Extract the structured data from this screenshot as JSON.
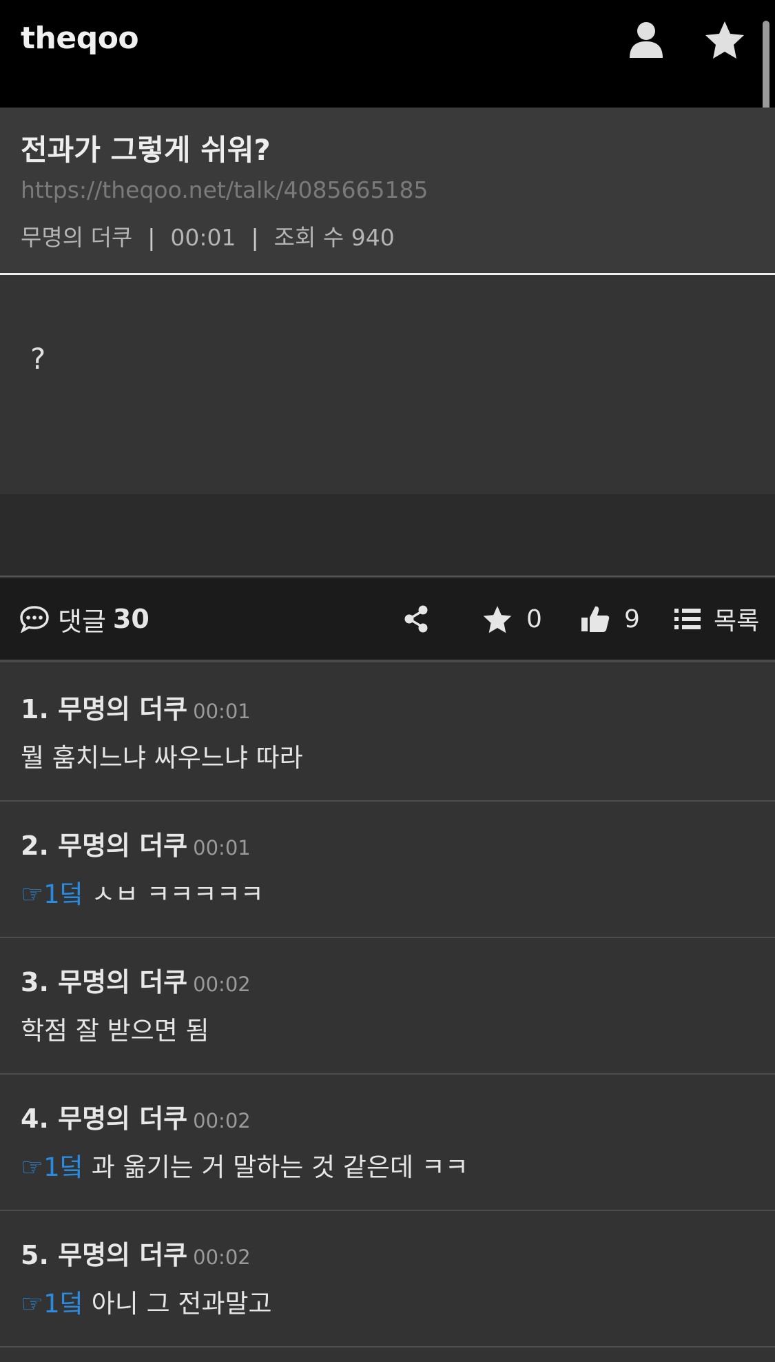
{
  "header": {
    "logo": "theqoo",
    "icons": [
      "user-icon",
      "star-icon"
    ]
  },
  "post": {
    "title": "전과가 그렇게 쉬워?",
    "url": "https://theqoo.net/talk/4085665185",
    "author": "무명의 더쿠",
    "time": "00:01",
    "views_label": "조회 수 940",
    "body": "?"
  },
  "actions": {
    "comments_label": "댓글",
    "comments_count": "30",
    "favorite_count": "0",
    "like_count": "9",
    "list_label": "목록"
  },
  "comments": [
    {
      "author": "1. 무명의 더쿠",
      "time": "00:01",
      "reply": "",
      "text": "뭘 훔치느냐 싸우느냐 따라"
    },
    {
      "author": "2. 무명의 더쿠",
      "time": "00:01",
      "reply": "☞1덬",
      "text": "ㅅㅂ ㅋㅋㅋㅋㅋ"
    },
    {
      "author": "3. 무명의 더쿠",
      "time": "00:02",
      "reply": "",
      "text": "학점 잘 받으면 됨"
    },
    {
      "author": "4. 무명의 더쿠",
      "time": "00:02",
      "reply": "☞1덬",
      "text": "과 옮기는 거 말하는 것 같은데 ㅋㅋ"
    },
    {
      "author": "5. 무명의 더쿠",
      "time": "00:02",
      "reply": "☞1덬",
      "text": "아니 그 전과말고"
    }
  ],
  "colors": {
    "header_bg": "#000000",
    "page_bg": "#333333",
    "actionbar_bg": "#1b1b1b",
    "reply_accent": "#2a8be0"
  }
}
